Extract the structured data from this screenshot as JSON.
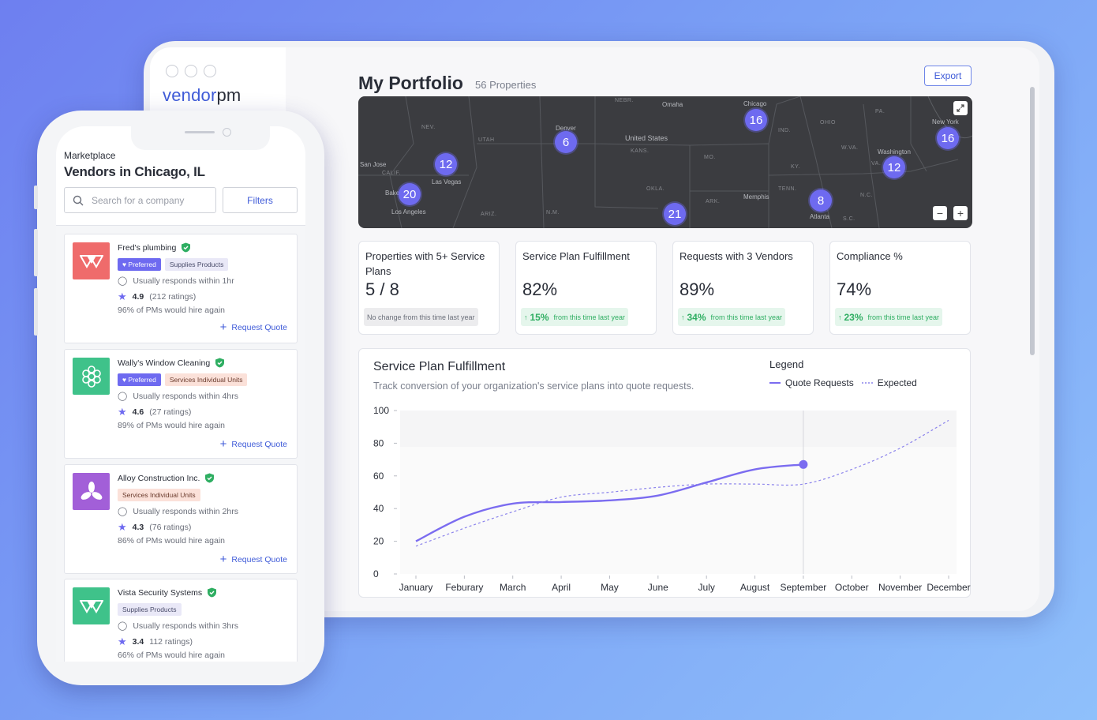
{
  "tablet": {
    "logo_brand": "vendor",
    "logo_suffix": "pm",
    "title": "My Portfolio",
    "property_count": "56 Properties",
    "export_label": "Export",
    "map": {
      "labels": [
        "NEBR.",
        "Omaha",
        "Chicago",
        "OHIO",
        "PA.",
        "New York",
        "NEV.",
        "Denver",
        "United States",
        "UTAH",
        "KANS.",
        "IND.",
        "W.VA.",
        "Washington",
        "San Jose",
        "CALIF.",
        "Las Vegas",
        "MO.",
        "KY.",
        "VA.",
        "Baker",
        "Los Angeles",
        "ARIZ.",
        "N.M.",
        "OKLA.",
        "ARK.",
        "TENN.",
        "Memphis",
        "N.C.",
        "Atlanta",
        "S.C."
      ],
      "pins": [
        "16",
        "6",
        "12",
        "16",
        "12",
        "20",
        "8",
        "21"
      ],
      "zoom_out": "−",
      "zoom_in": "+",
      "expand_icon": "expand-icon"
    },
    "metrics": [
      {
        "title": "Properties with 5+ Service Plans",
        "value": "5 / 8",
        "change_pct": "",
        "change_text": "No change from this time last year",
        "trend": "neutral"
      },
      {
        "title": "Service Plan Fulfillment",
        "value": "82%",
        "change_pct": "15%",
        "change_text": "from this time last year",
        "trend": "up"
      },
      {
        "title": "Requests with 3 Vendors",
        "value": "89%",
        "change_pct": "34%",
        "change_text": "from this time last year",
        "trend": "up"
      },
      {
        "title": "Compliance %",
        "value": "74%",
        "change_pct": "23%",
        "change_text": "from this time last year",
        "trend": "up"
      }
    ]
  },
  "chart_data": {
    "type": "line",
    "title": "Service Plan Fulfillment",
    "subtitle": "Track conversion of your organization's service plans into quote requests.",
    "legend_title": "Legend",
    "legend_placement": "top-right",
    "categories": [
      "January",
      "Feburary",
      "March",
      "April",
      "May",
      "June",
      "July",
      "August",
      "September",
      "October",
      "November",
      "December"
    ],
    "ylim": [
      0,
      100
    ],
    "yticks": [
      0,
      20,
      40,
      60,
      80,
      100
    ],
    "grid": false,
    "series": [
      {
        "name": "Quote Requests",
        "style": "solid",
        "color": "#7b6cf0",
        "values": [
          20,
          35,
          43,
          44,
          45,
          48,
          56,
          64,
          67,
          null,
          null,
          null
        ]
      },
      {
        "name": "Expected",
        "style": "dashed",
        "color": "#8c84ec",
        "values": [
          17,
          28,
          38,
          47,
          50,
          53,
          55,
          55,
          55,
          64,
          77,
          94
        ]
      }
    ],
    "highlight_index": 8
  },
  "phone": {
    "section": "Marketplace",
    "title": "Vendors in Chicago, IL",
    "search_placeholder": "Search for a company",
    "filters_label": "Filters",
    "request_label": "Request Quote",
    "vendors": [
      {
        "name": "Fred's plumbing",
        "badges": [
          "Preferred",
          "Supplies Products"
        ],
        "responds": "Usually responds within 1hr",
        "rating": "4.9",
        "ratings_count": "(212 ratings)",
        "hire_again": "96% of PMs would hire again",
        "logo_color": "#ef6b6b"
      },
      {
        "name": "Wally's Window Cleaning",
        "badges": [
          "Preferred",
          "Services Individual Units"
        ],
        "responds": "Usually responds within 4hrs",
        "rating": "4.6",
        "ratings_count": "(27 ratings)",
        "hire_again": "89% of PMs would hire again",
        "logo_color": "#3fc28a"
      },
      {
        "name": "Alloy Construction Inc.",
        "badges": [
          "Services Individual Units"
        ],
        "responds": "Usually responds within 2hrs",
        "rating": "4.3",
        "ratings_count": "(76 ratings)",
        "hire_again": "86% of PMs would hire again",
        "logo_color": "#a25fd8"
      },
      {
        "name": "Vista Security Systems",
        "badges": [
          "Supplies Products"
        ],
        "responds": "Usually responds within 3hrs",
        "rating": "3.4",
        "ratings_count": "112 ratings)",
        "hire_again": "66% of PMs would hire again",
        "logo_color": "#3fc28a"
      }
    ]
  }
}
